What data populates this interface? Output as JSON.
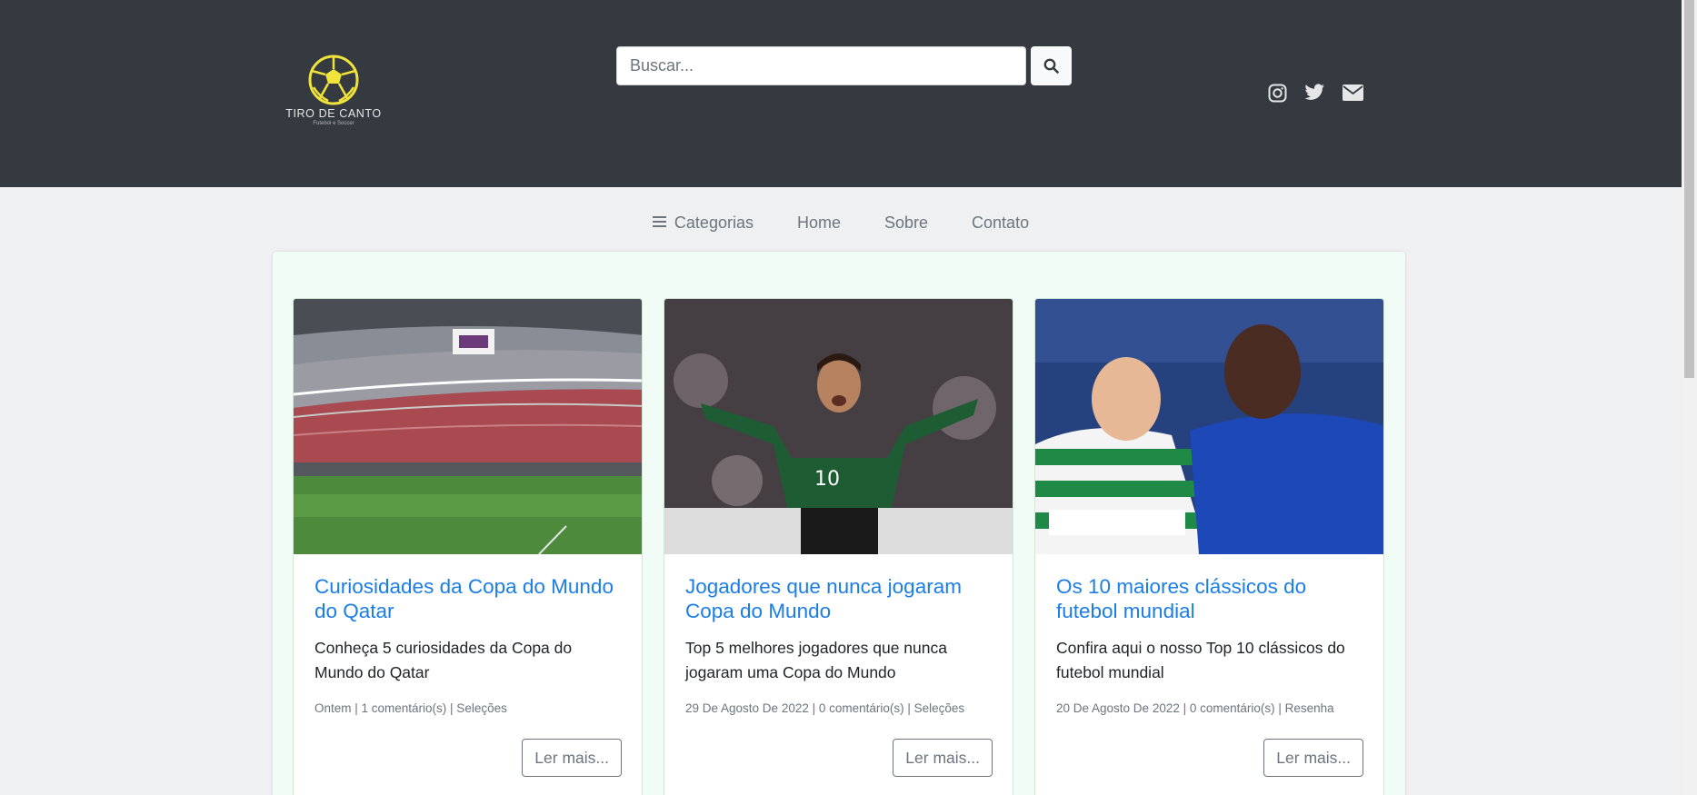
{
  "header": {
    "logo": {
      "title": "TIRO DE CANTO",
      "subtitle": "Futebol e Soccer"
    },
    "search": {
      "placeholder": "Buscar...",
      "button_icon": "search-icon"
    },
    "social": [
      "instagram-icon",
      "twitter-icon",
      "envelope-icon"
    ]
  },
  "nav": {
    "categories_label": "Categorias",
    "items": [
      "Home",
      "Sobre",
      "Contato"
    ]
  },
  "cards": [
    {
      "title": "Curiosidades da Copa do Mundo do Qatar",
      "text": "Conheça 5 curiosidades da Copa do Mundo do Qatar",
      "meta": "Ontem | 1 comentário(s) | Seleções",
      "button": "Ler mais...",
      "image": "stadium-photo"
    },
    {
      "title": "Jogadores que nunca jogaram Copa do Mundo",
      "text": "Top 5 melhores jogadores que nunca jogaram uma Copa do Mundo",
      "meta": "29 De Agosto De 2022 | 0 comentário(s) | Seleções",
      "button": "Ler mais...",
      "image": "player-celebrating-photo"
    },
    {
      "title": "Os 10 maiores clássicos do futebol mundial",
      "text": "Confira aqui o nosso Top 10 clássicos do futebol mundial",
      "meta": "20 De Agosto De 2022 | 0 comentário(s) | Resenha",
      "button": "Ler mais...",
      "image": "players-confrontation-photo"
    }
  ],
  "colors": {
    "header_bg": "#343a40",
    "link": "#1a7ee6",
    "logo_ball": "#f0e33a",
    "content_bg": "#f2fcf6"
  }
}
